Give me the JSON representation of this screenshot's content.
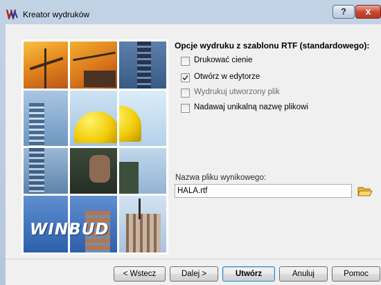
{
  "window": {
    "title": "Kreator wydruków",
    "help": "?",
    "close": "x"
  },
  "options": {
    "title": "Opcje wydruku z szablonu RTF (standardowego):",
    "items": [
      {
        "label": "Drukować cienie",
        "checked": false,
        "enabled": true
      },
      {
        "label": "Otwórz w edytorze",
        "checked": true,
        "enabled": true
      },
      {
        "label": "Wydrukuj utworzony plik",
        "checked": false,
        "enabled": false
      },
      {
        "label": "Nadawaj unikalną nazwę plikowi",
        "checked": false,
        "enabled": true
      }
    ]
  },
  "output_file": {
    "label": "Nazwa pliku wynikowego:",
    "value": "HALA.rtf"
  },
  "logo": {
    "text": "WINBUD"
  },
  "buttons": {
    "back": "< Wstecz",
    "next": "Dalej >",
    "create": "Utwórz",
    "cancel": "Anuluj",
    "help": "Pomoc"
  }
}
